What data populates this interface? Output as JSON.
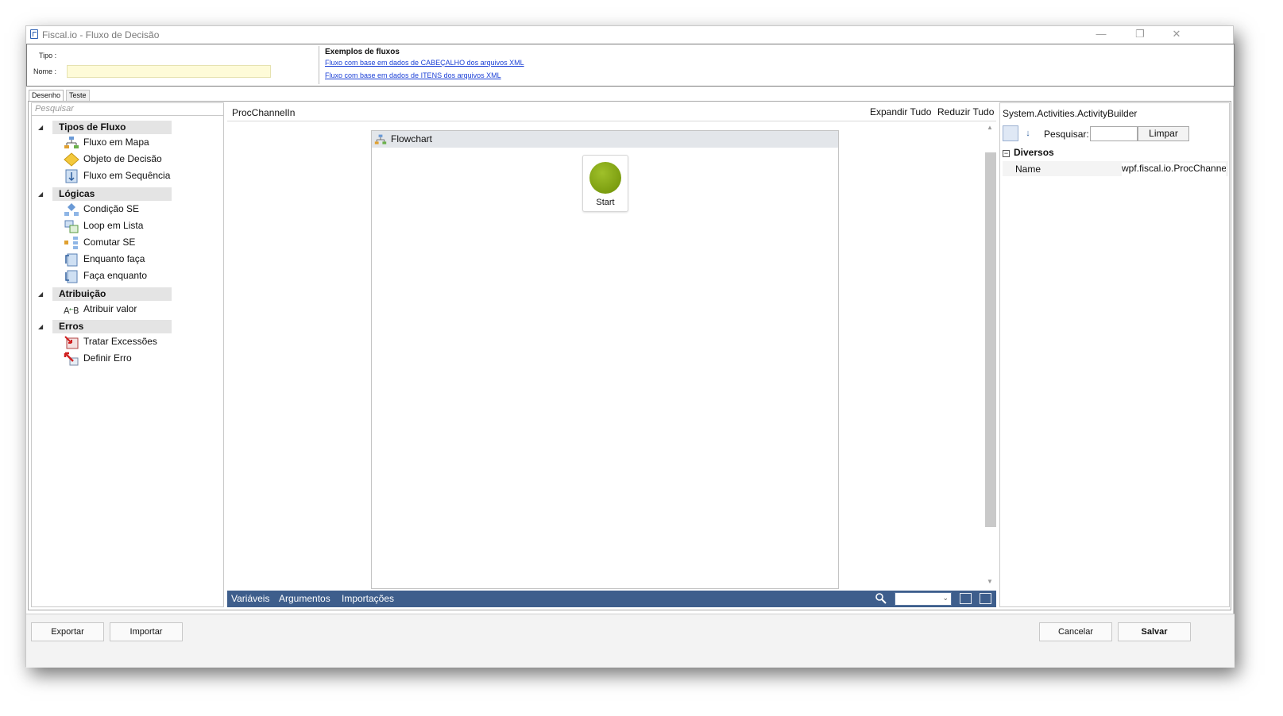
{
  "window": {
    "title": "Fiscal.io - Fluxo de Decisão",
    "minimize": "—",
    "restore": "❐",
    "close": "✕"
  },
  "header": {
    "tipo_label": "Tipo :",
    "nome_label": "Nome :",
    "nome_value": "",
    "examples_title": "Exemplos de fluxos",
    "example_links": [
      "Fluxo com base em dados de CABEÇALHO dos arquivos XML",
      "Fluxo com base em dados de ITENS dos arquivos XML"
    ]
  },
  "tabs": [
    "Desenho",
    "Teste"
  ],
  "toolbox": {
    "search_placeholder": "Pesquisar",
    "categories": [
      {
        "label": "Tipos de Fluxo",
        "items": [
          {
            "label": "Fluxo em Mapa",
            "icon": "flowchart-icon"
          },
          {
            "label": "Objeto de Decisão",
            "icon": "decision-icon"
          },
          {
            "label": "Fluxo em Sequência",
            "icon": "sequence-icon"
          }
        ]
      },
      {
        "label": "Lógicas",
        "items": [
          {
            "label": "Condição SE",
            "icon": "if-icon"
          },
          {
            "label": "Loop em Lista",
            "icon": "foreach-icon"
          },
          {
            "label": "Comutar SE",
            "icon": "switch-icon"
          },
          {
            "label": "Enquanto faça",
            "icon": "while-icon"
          },
          {
            "label": "Faça enquanto",
            "icon": "dowhile-icon"
          }
        ]
      },
      {
        "label": "Atribuição",
        "items": [
          {
            "label": "Atribuir valor",
            "icon": "assign-icon"
          }
        ]
      },
      {
        "label": "Erros",
        "items": [
          {
            "label": "Tratar Excessões",
            "icon": "trycatch-icon"
          },
          {
            "label": "Definir Erro",
            "icon": "throw-icon"
          }
        ]
      }
    ]
  },
  "canvas": {
    "breadcrumb": "ProcChannelIn",
    "expand_all": "Expandir Tudo",
    "collapse_all": "Reduzir Tudo",
    "flowchart_title": "Flowchart",
    "start_label": "Start",
    "bottom_tabs": [
      "Variáveis",
      "Argumentos",
      "Importações"
    ],
    "zoom_value": ""
  },
  "properties": {
    "type_title": "System.Activities.ActivityBuilder",
    "search_label": "Pesquisar:",
    "clear_button": "Limpar",
    "category": "Diversos",
    "rows": [
      {
        "name": "Name",
        "value": "wpf.fiscal.io.ProcChannelIn"
      }
    ]
  },
  "footer": {
    "export": "Exportar",
    "import": "Importar",
    "cancel": "Cancelar",
    "save": "Salvar"
  },
  "colors": {
    "bottom_bar": "#3e5e8c",
    "start_node": "#7ea10f",
    "link": "#1a3fd6",
    "name_field": "#fefbd8"
  }
}
